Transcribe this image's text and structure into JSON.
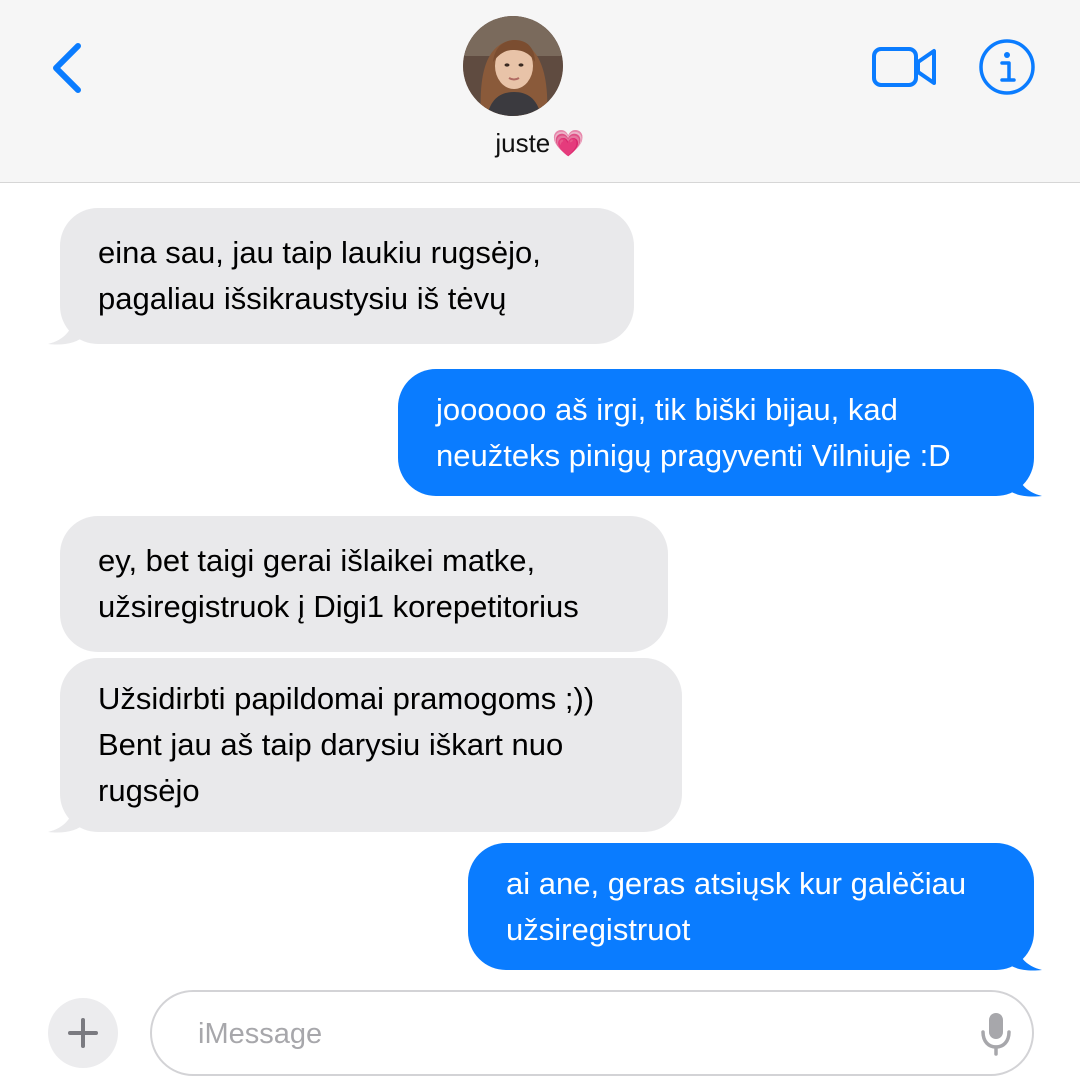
{
  "header": {
    "contact_name": "juste",
    "contact_emoji": "💗",
    "back_icon": "chevron-left-icon",
    "video_icon": "video-camera-icon",
    "info_icon": "info-icon",
    "accent_color": "#0a7cff"
  },
  "messages": [
    {
      "direction": "incoming",
      "text": "eina sau, jau taip laukiu rugsėjo,\npagaliau išsikraustysiu iš tėvų"
    },
    {
      "direction": "outgoing",
      "text": "joooooo aš irgi, tik biški bijau, kad\nneužteks pinigų pragyventi Vilniuje :D"
    },
    {
      "direction": "incoming",
      "text": "ey, bet taigi gerai išlaikei matke,\nužsiregistruok į Digi1 korepetitorius"
    },
    {
      "direction": "incoming",
      "text": "Užsidirbti papildomai pramogoms ;))\nBent jau aš taip darysiu iškart nuo\nrugsėjo"
    },
    {
      "direction": "outgoing",
      "text": "ai ane, geras atsiųsk kur galėčiau\nužsiregistruot"
    }
  ],
  "composer": {
    "placeholder": "iMessage",
    "value": "",
    "plus_icon": "plus-icon",
    "mic_icon": "microphone-icon"
  },
  "colors": {
    "incoming_bubble": "#e9e9eb",
    "outgoing_bubble": "#0a7cff",
    "header_bg": "#f6f6f6"
  }
}
